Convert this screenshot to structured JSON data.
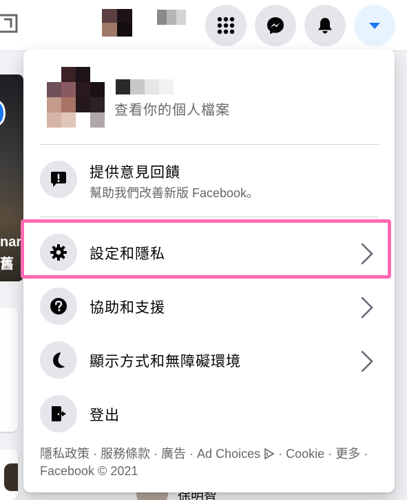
{
  "colors": {
    "accent": "#1877f2",
    "highlight": "#ff69b4",
    "secondary_text": "#65676b",
    "icon_bg": "#e4e6eb"
  },
  "topbar": {
    "icons": [
      "watch-icon",
      "menu-grid-icon",
      "messenger-icon",
      "notifications-bell-icon",
      "account-dropdown-icon"
    ]
  },
  "menu": {
    "profile": {
      "subtitle": "查看你的個人檔案"
    },
    "feedback": {
      "label": "提供意見回饋",
      "sublabel": "幫助我們改善新版 Facebook。",
      "icon": "feedback-exclamation-icon"
    },
    "items": [
      {
        "label": "設定和隱私",
        "icon": "gear-icon"
      },
      {
        "label": "協助和支援",
        "icon": "question-icon"
      },
      {
        "label": "顯示方式和無障礙環境",
        "icon": "moon-icon"
      },
      {
        "label": "登出",
        "icon": "logout-icon"
      }
    ],
    "footer": {
      "privacy": "隱私政策",
      "terms": "服務條款",
      "ads": "廣告",
      "ad_choices": "Ad Choices",
      "cookie": "Cookie",
      "more": "更多",
      "copyright": "Facebook © 2021"
    }
  },
  "background": {
    "story_text": "nar",
    "story_text_2": "舊",
    "bottom_name": "徐明智"
  }
}
